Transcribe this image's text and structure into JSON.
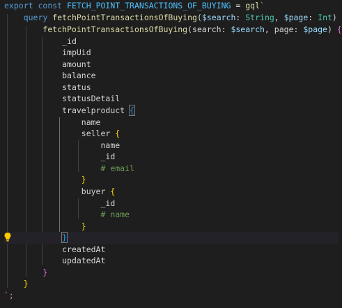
{
  "editor": {
    "tokens": {
      "l1": {
        "export": "export",
        "const": "const",
        "name": "FETCH_POINT_TRANSACTIONS_OF_BUYING",
        "eq": " = ",
        "gql": "gql",
        "tick": "`"
      },
      "l2": {
        "query": "query",
        "fn": "fetchPointTransactionsOfBuying",
        "open": "(",
        "p1": "$search",
        "c1": ": ",
        "t1": "String",
        "comma": ", ",
        "p2": "$page",
        "c2": ": ",
        "t2": "Int",
        "close": ")",
        "brace": "{"
      },
      "l3": {
        "fn": "fetchPointTransactionsOfBuying",
        "open": "(",
        "a1": "search",
        "c1": ": ",
        "v1": "$search",
        "comma": ", ",
        "a2": "page",
        "c2": ": ",
        "v2": "$page",
        "close": ")",
        "brace": "{"
      },
      "fields": {
        "id": "_id",
        "impUid": "impUid",
        "amount": "amount",
        "balance": "balance",
        "status": "status",
        "statusDetail": "statusDetail",
        "travelproduct": "travelproduct",
        "name": "name",
        "seller": "seller",
        "seller_name": "name",
        "seller_id": "_id",
        "seller_comment": "# email",
        "buyer": "buyer",
        "buyer_id": "_id",
        "buyer_comment": "# name",
        "createdAt": "createdAt",
        "updatedAt": "updatedAt"
      },
      "braces": {
        "open": "{",
        "close": "}"
      },
      "end": "`;"
    },
    "colors": {
      "background": "#1e1e1e",
      "keyword": "#569cd6",
      "function": "#dcdcaa",
      "type": "#4ec9b0",
      "comment": "#6a9955",
      "bracket1": "#ffd700",
      "bracket2": "#da70d6",
      "bracket3": "#179fff"
    },
    "icons": {
      "gutter": "lightbulb-icon"
    }
  }
}
